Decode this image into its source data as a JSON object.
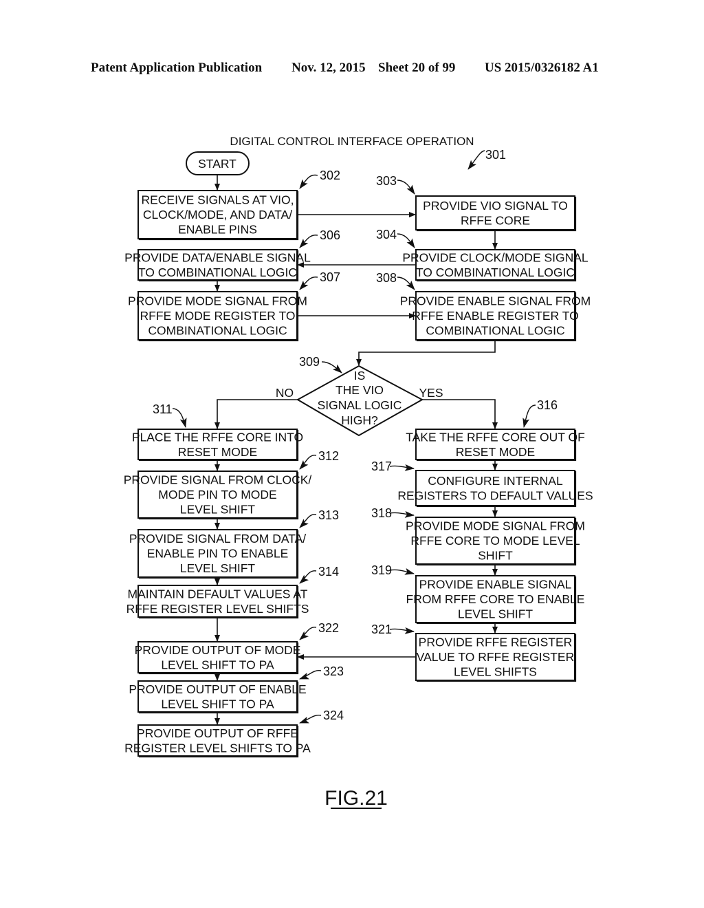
{
  "header": {
    "publication": "Patent Application Publication",
    "date": "Nov. 12, 2015",
    "sheet": "Sheet 20 of 99",
    "number": "US 2015/0326182 A1"
  },
  "diagram": {
    "title": "DIGITAL CONTROL INTERFACE OPERATION",
    "figure_ref": "301",
    "figure_label": "FIG.21",
    "start": "START",
    "decision": {
      "ref": "309",
      "lines": [
        "IS",
        "THE VIO",
        "SIGNAL LOGIC",
        "HIGH?"
      ],
      "no_label": "NO",
      "yes_label": "YES"
    },
    "nodes": {
      "n302": {
        "ref": "302",
        "lines": [
          "RECEIVE SIGNALS AT VIO,",
          "CLOCK/MODE, AND DATA/",
          "ENABLE PINS"
        ]
      },
      "n303": {
        "ref": "303",
        "lines": [
          "PROVIDE VIO SIGNAL TO",
          "RFFE CORE"
        ]
      },
      "n304": {
        "ref": "304",
        "lines": [
          "PROVIDE CLOCK/MODE SIGNAL",
          "TO COMBINATIONAL LOGIC"
        ]
      },
      "n306": {
        "ref": "306",
        "lines": [
          "PROVIDE DATA/ENABLE SIGNAL",
          "TO COMBINATIONAL LOGIC"
        ]
      },
      "n307": {
        "ref": "307",
        "lines": [
          "PROVIDE MODE SIGNAL FROM",
          "RFFE MODE REGISTER TO",
          "COMBINATIONAL LOGIC"
        ]
      },
      "n308": {
        "ref": "308",
        "lines": [
          "PROVIDE ENABLE SIGNAL FROM",
          "RFFE ENABLE REGISTER TO",
          "COMBINATIONAL LOGIC"
        ]
      },
      "n311": {
        "ref": "311",
        "lines": [
          "PLACE THE RFFE CORE INTO",
          "RESET MODE"
        ]
      },
      "n312": {
        "ref": "312",
        "lines": [
          "PROVIDE SIGNAL FROM CLOCK/",
          "MODE PIN TO MODE",
          "LEVEL SHIFT"
        ]
      },
      "n313": {
        "ref": "313",
        "lines": [
          "PROVIDE SIGNAL FROM DATA/",
          "ENABLE PIN TO ENABLE",
          "LEVEL SHIFT"
        ]
      },
      "n314": {
        "ref": "314",
        "lines": [
          "MAINTAIN DEFAULT VALUES AT",
          "RFFE REGISTER LEVEL SHIFTS"
        ]
      },
      "n316": {
        "ref": "316",
        "lines": [
          "TAKE THE RFFE CORE OUT OF",
          "RESET MODE"
        ]
      },
      "n317": {
        "ref": "317",
        "lines": [
          "CONFIGURE INTERNAL",
          "REGISTERS TO DEFAULT VALUES"
        ]
      },
      "n318": {
        "ref": "318",
        "lines": [
          "PROVIDE MODE SIGNAL FROM",
          "RFFE CORE TO MODE LEVEL",
          "SHIFT"
        ]
      },
      "n319": {
        "ref": "319",
        "lines": [
          "PROVIDE ENABLE SIGNAL",
          "FROM RFFE CORE TO ENABLE",
          "LEVEL SHIFT"
        ]
      },
      "n321": {
        "ref": "321",
        "lines": [
          "PROVIDE RFFE REGISTER",
          "VALUE TO RFFE REGISTER",
          "LEVEL SHIFTS"
        ]
      },
      "n322": {
        "ref": "322",
        "lines": [
          "PROVIDE OUTPUT OF MODE",
          "LEVEL SHIFT TO PA"
        ]
      },
      "n323": {
        "ref": "323",
        "lines": [
          "PROVIDE OUTPUT OF ENABLE",
          "LEVEL SHIFT TO PA"
        ]
      },
      "n324": {
        "ref": "324",
        "lines": [
          "PROVIDE OUTPUT OF RFFE",
          "REGISTER LEVEL SHIFTS TO PA"
        ]
      }
    }
  }
}
